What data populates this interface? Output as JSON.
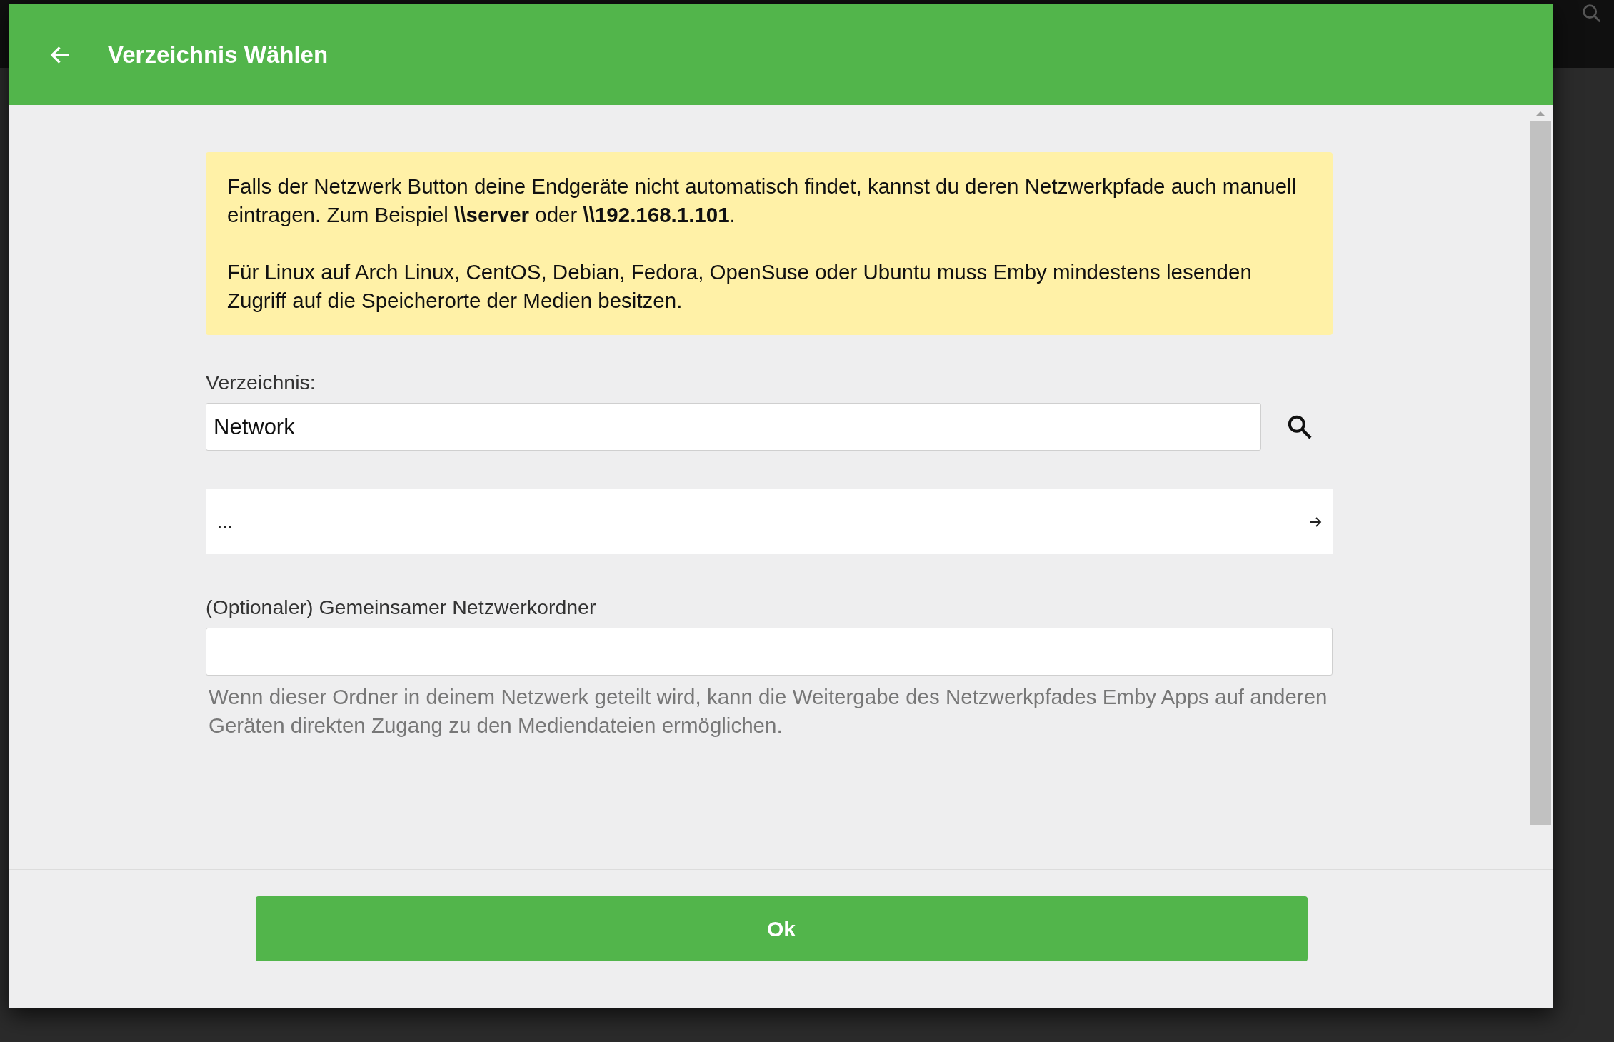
{
  "dialog": {
    "title": "Verzeichnis Wählen",
    "notice": [
      "Falls der Netzwerk Button deine Endgeräte nicht automatisch findet, kannst du deren Netzwerkpfade auch manuell eintragen. Zum Beispiel **\\\\server** oder **\\\\192.168.1.101**.",
      "Für Linux auf Arch Linux, CentOS, Debian, Fedora, OpenSuse oder Ubuntu muss Emby mindestens lesenden Zugriff auf die Speicherorte der Medien besitzen."
    ],
    "directory": {
      "label": "Verzeichnis:",
      "value": "Network"
    },
    "entries": [
      {
        "label": "..."
      }
    ],
    "share": {
      "label": "(Optionaler) Gemeinsamer Netzwerkordner",
      "help": "Wenn dieser Ordner in deinem Netzwerk geteilt wird, kann die Weitergabe des Netzwerkpfades Emby Apps auf anderen Geräten direkten Zugang zu den Mediendateien ermöglichen."
    },
    "buttons": [
      "Ok"
    ]
  }
}
